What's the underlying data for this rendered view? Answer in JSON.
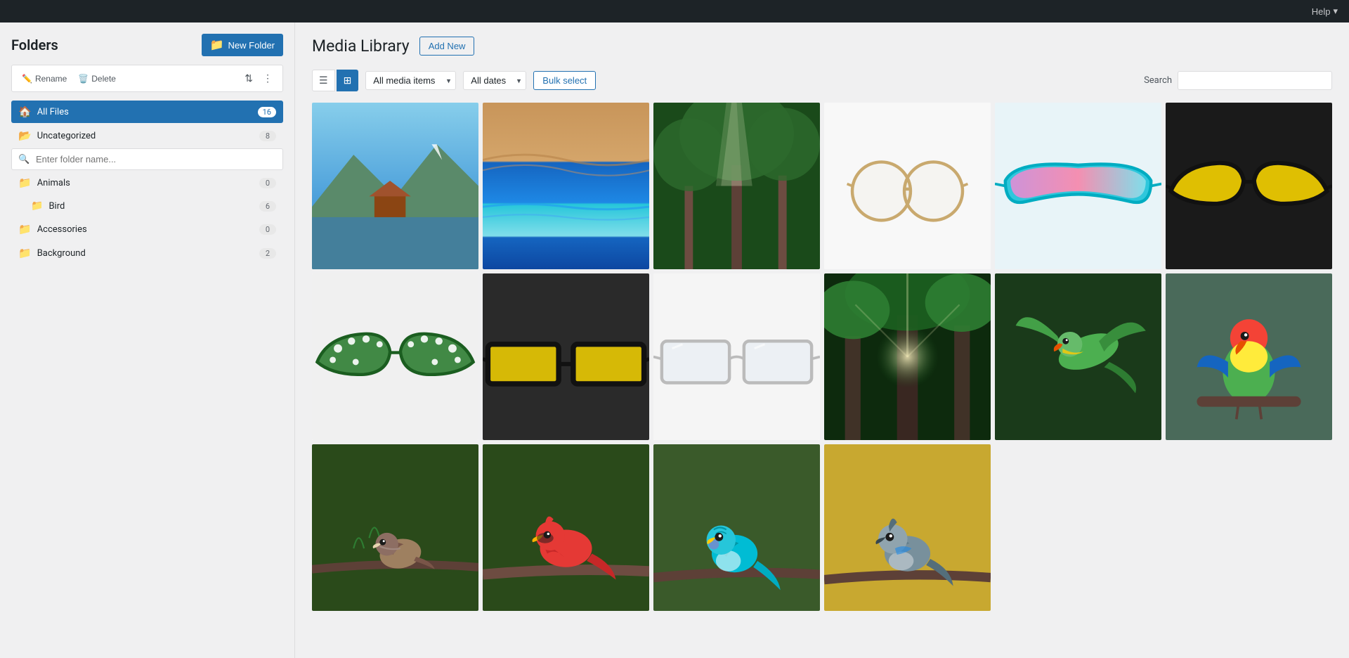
{
  "topbar": {
    "help_label": "Help",
    "chevron": "▾"
  },
  "sidebar": {
    "title": "Folders",
    "new_folder_btn": "New Folder",
    "toolbar": {
      "rename_btn": "Rename",
      "delete_btn": "Delete"
    },
    "folder_input_placeholder": "Enter folder name...",
    "folders": [
      {
        "id": "all-files",
        "name": "All Files",
        "count": "16",
        "active": true,
        "indent": 0
      },
      {
        "id": "uncategorized",
        "name": "Uncategorized",
        "count": "8",
        "active": false,
        "indent": 0
      },
      {
        "id": "animals",
        "name": "Animals",
        "count": "0",
        "active": false,
        "indent": 0
      },
      {
        "id": "bird",
        "name": "Bird",
        "count": "6",
        "active": false,
        "indent": 1
      },
      {
        "id": "accessories",
        "name": "Accessories",
        "count": "0",
        "active": false,
        "indent": 0
      },
      {
        "id": "background",
        "name": "Background",
        "count": "2",
        "active": false,
        "indent": 0
      }
    ]
  },
  "content": {
    "title": "Media Library",
    "add_new_btn": "Add New",
    "filter": {
      "media_items_label": "All media items",
      "dates_label": "All dates",
      "bulk_select_btn": "Bulk select",
      "search_label": "Search",
      "search_placeholder": ""
    },
    "media_items": [
      {
        "id": 1,
        "type": "landscape",
        "alt": "Mountain lake with house"
      },
      {
        "id": 2,
        "type": "desert-ocean",
        "alt": "Desert and ocean layers"
      },
      {
        "id": 3,
        "type": "forest-sun",
        "alt": "Forest with sunlight"
      },
      {
        "id": 4,
        "type": "glasses-round-clear",
        "alt": "Round clear glasses"
      },
      {
        "id": 5,
        "type": "glasses-sport-pink",
        "alt": "Sport glasses pink"
      },
      {
        "id": 6,
        "type": "glasses-cat-yellow",
        "alt": "Cat eye glasses yellow"
      },
      {
        "id": 7,
        "type": "glasses-cat-green",
        "alt": "Cat eye glasses green"
      },
      {
        "id": 8,
        "type": "glasses-rect-yellow",
        "alt": "Rectangular glasses yellow"
      },
      {
        "id": 9,
        "type": "glasses-clear-frame",
        "alt": "Clear frame glasses"
      },
      {
        "id": 10,
        "type": "forest-tall",
        "alt": "Tall forest trees"
      },
      {
        "id": 11,
        "type": "parrot-green",
        "alt": "Green parrot flying"
      },
      {
        "id": 12,
        "type": "bird-colorful",
        "alt": "Colorful bird on branch"
      },
      {
        "id": 13,
        "type": "bird-sparrow",
        "alt": "Small sparrow on branch"
      },
      {
        "id": 14,
        "type": "bird-red",
        "alt": "Red bird on branch"
      },
      {
        "id": 15,
        "type": "bird-blue-parrot",
        "alt": "Blue parrot on branch"
      },
      {
        "id": 16,
        "type": "bird-gray",
        "alt": "Gray bird on branch"
      }
    ]
  }
}
